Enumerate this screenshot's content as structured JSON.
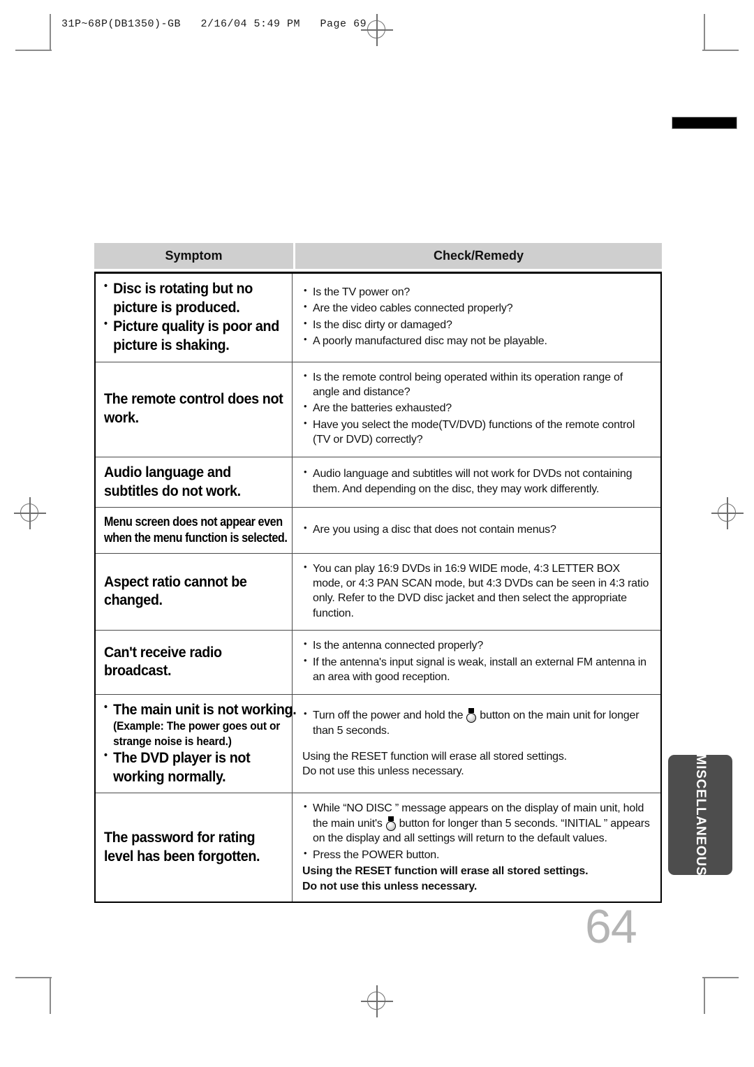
{
  "print_header": "31P~68P(DB1350)-GB   2/16/04 5:49 PM   Page 69",
  "page_number": "64",
  "side_tab": {
    "label": "MISCELLANEOUS"
  },
  "table": {
    "headers": {
      "symptom": "Symptom",
      "remedy": "Check/Remedy"
    },
    "rows": [
      {
        "symptom_lines": [
          "Disc is rotating but no",
          "picture is produced.",
          "Picture quality is poor and",
          "picture is shaking."
        ],
        "remedy_items": [
          "Is the TV power on?",
          "Are the video cables connected properly?",
          "Is the disc dirty or damaged?",
          "A poorly manufactured disc may not be playable."
        ]
      },
      {
        "symptom_lines": [
          "The remote control does not",
          "work."
        ],
        "remedy_items": [
          "Is the remote control being operated within its operation range of angle and distance?",
          "Are the batteries exhausted?",
          "Have you select the mode(TV/DVD) functions of the remote control (TV or DVD) correctly?"
        ]
      },
      {
        "symptom_lines": [
          "Audio language and",
          "subtitles do not work."
        ],
        "remedy_items": [
          "Audio language and subtitles will not work for DVDs not containing them. And depending on the disc, they may work differently."
        ]
      },
      {
        "symptom_lines": [
          "Menu screen does not appear even",
          "when the menu function is selected."
        ],
        "remedy_items": [
          "Are you using a disc that does not contain menus?"
        ]
      },
      {
        "symptom_lines": [
          "Aspect ratio cannot be",
          "changed."
        ],
        "remedy_items": [
          "You can play 16:9 DVDs in 16:9 WIDE mode, 4:3 LETTER BOX mode, or 4:3 PAN SCAN mode, but 4:3 DVDs can be seen in 4:3 ratio only. Refer to the DVD disc jacket and then select the appropriate function."
        ]
      },
      {
        "symptom_lines": [
          "Can't receive radio",
          "broadcast."
        ],
        "remedy_items": [
          "Is the antenna connected properly?",
          "If the antenna's input signal is weak, install an external FM antenna in an area with good reception."
        ]
      },
      {
        "symptom_lines": [
          "The main unit is not working.",
          "(Example: The power goes out or",
          "strange noise is heard.)",
          "The DVD player is not",
          "working normally."
        ],
        "remedy_main_pre": "Turn off the power and hold the",
        "remedy_main_post": "button on the main unit for longer than 5 seconds.",
        "remedy_note_1": "Using the RESET function will erase all stored settings.",
        "remedy_note_2": "Do not use this unless necessary."
      },
      {
        "symptom_lines": [
          "The password for rating",
          "level has been forgotten."
        ],
        "remedy_main_pre": "While “NO DISC ” message appears on the display of main unit, hold the main unit's",
        "remedy_main_post": "button for longer than 5 seconds. “INITIAL  ” appears on the display and all settings will return to the default values.",
        "remedy_item_2": "Press the POWER button.",
        "remedy_note_1": "Using the RESET function will erase all stored settings.",
        "remedy_note_2": "Do not use this unless necessary."
      }
    ]
  },
  "icons": {
    "main_unit_button": "stop-power-button-icon"
  }
}
